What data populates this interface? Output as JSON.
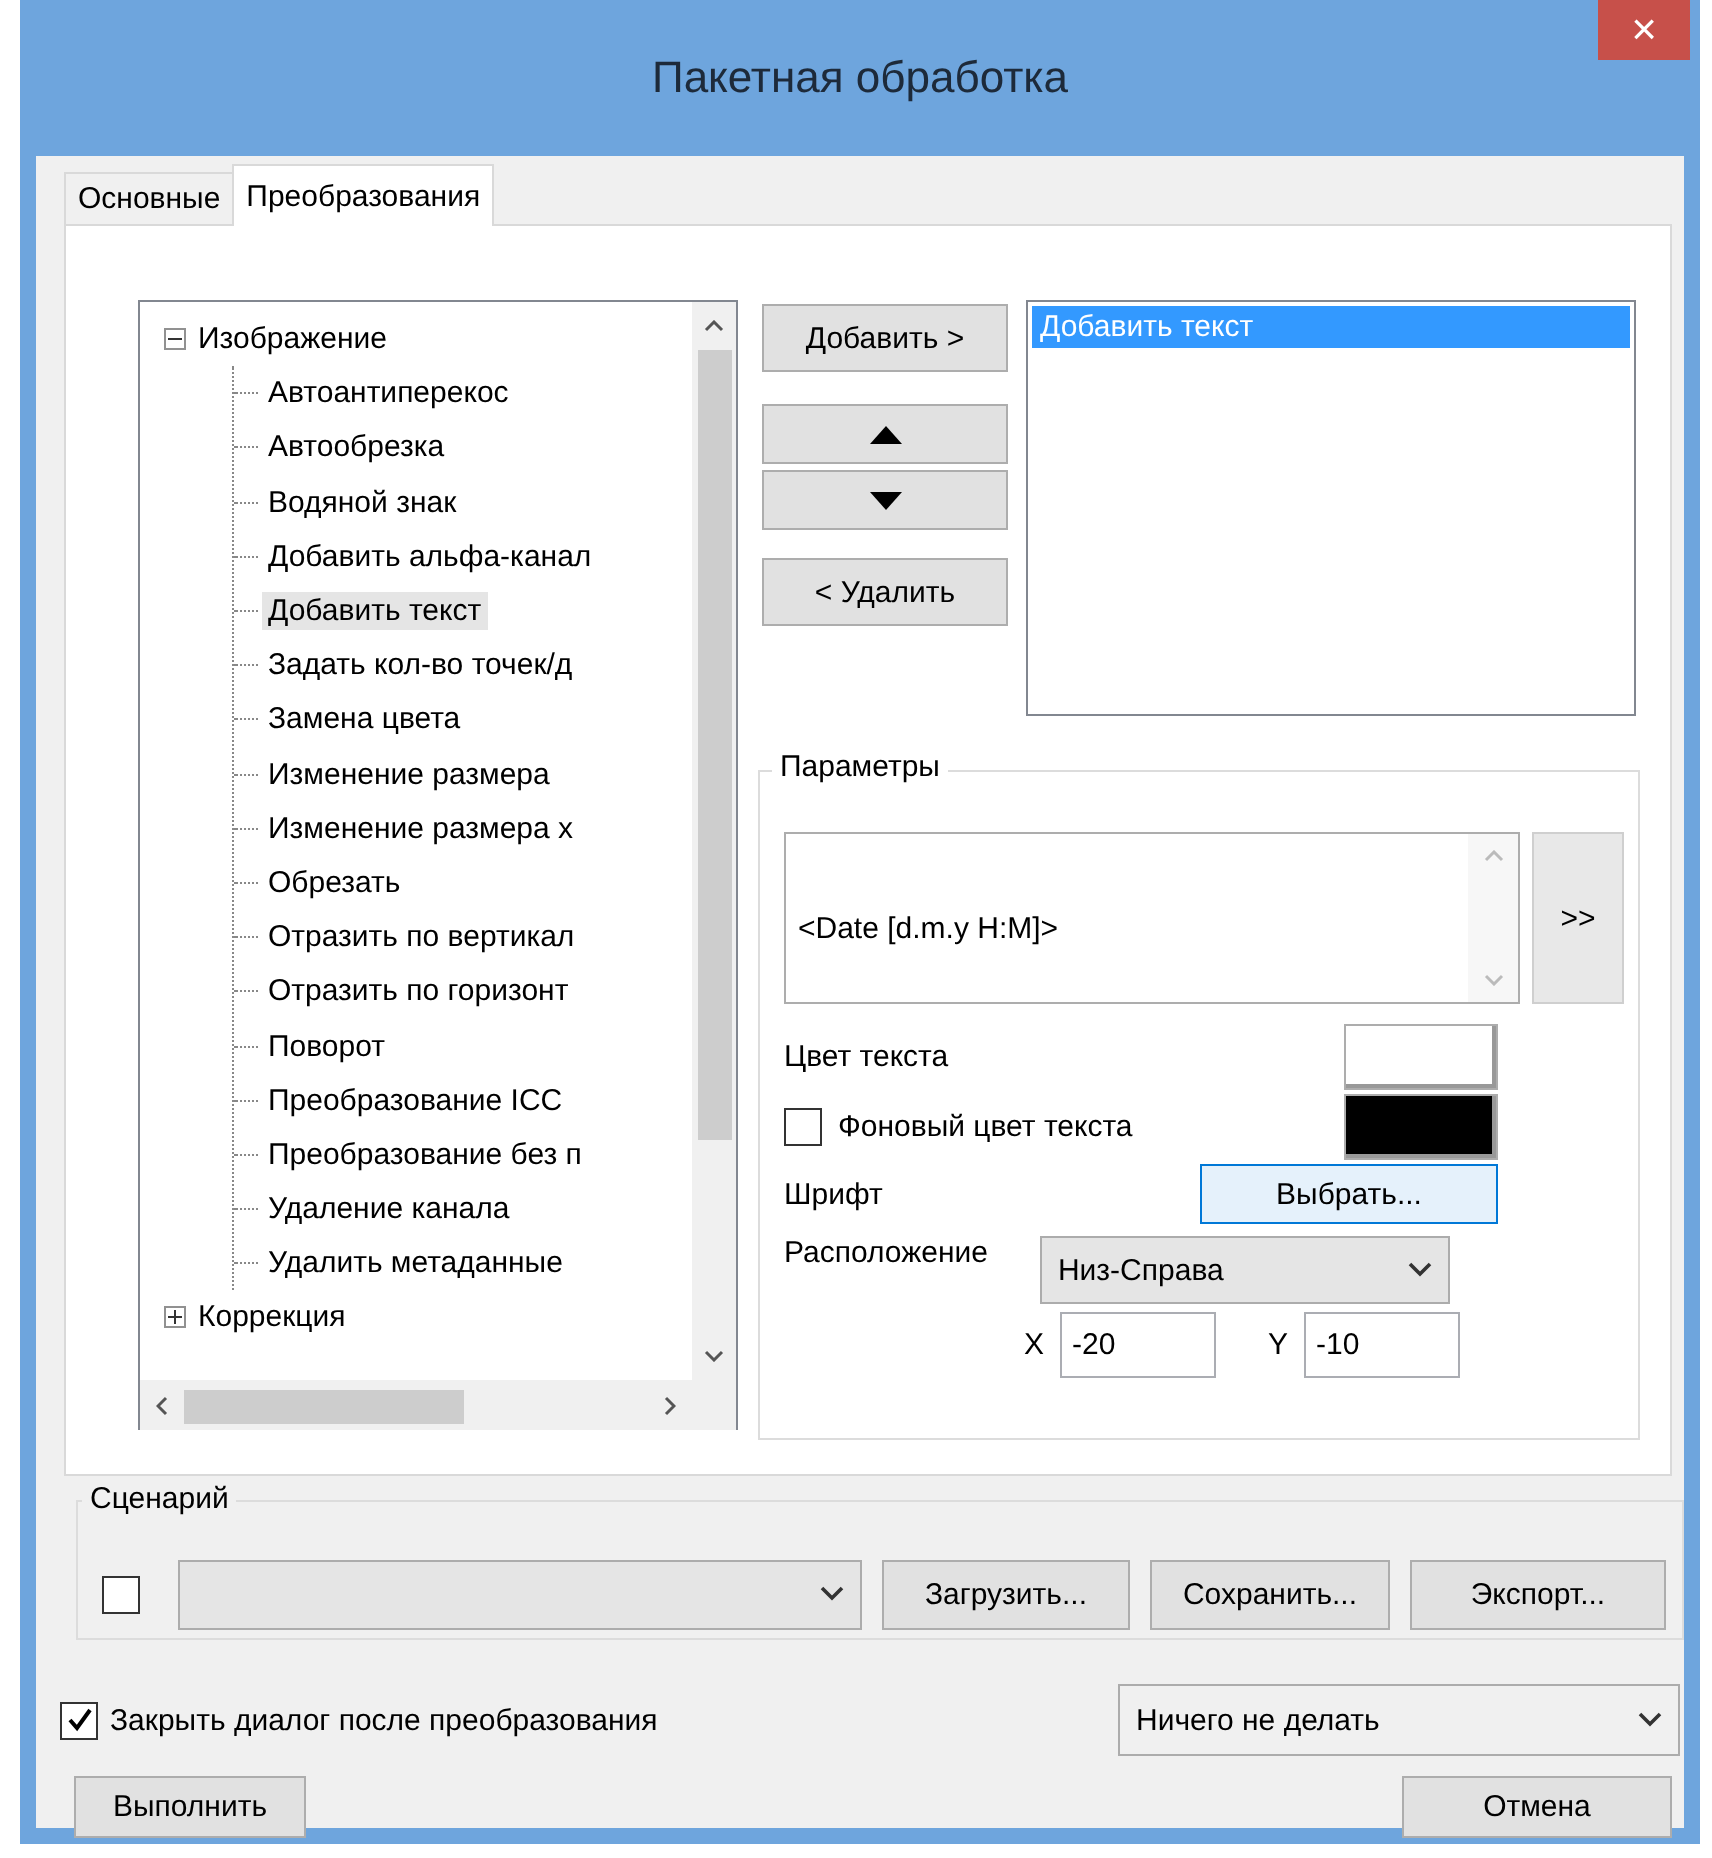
{
  "window": {
    "title": "Пакетная обработка",
    "close": "×"
  },
  "tabs": [
    {
      "label": "Основные",
      "selected": false
    },
    {
      "label": "Преобразования",
      "selected": true
    }
  ],
  "tree": [
    {
      "label": "Изображение",
      "expanded": true,
      "selected": false,
      "children": [
        {
          "label": "Автоантиперекос",
          "selected": false
        },
        {
          "label": "Автообрезка",
          "selected": false
        },
        {
          "label": "Водяной знак",
          "selected": false
        },
        {
          "label": "Добавить альфа-канал",
          "selected": false
        },
        {
          "label": "Добавить текст",
          "selected": true
        },
        {
          "label": "Задать кол-во точек/д",
          "selected": false
        },
        {
          "label": "Замена цвета",
          "selected": false
        },
        {
          "label": "Изменение размера",
          "selected": false
        },
        {
          "label": "Изменение размера х",
          "selected": false
        },
        {
          "label": "Обрезать",
          "selected": false
        },
        {
          "label": "Отразить по вертикал",
          "selected": false
        },
        {
          "label": "Отразить по горизонт",
          "selected": false
        },
        {
          "label": "Поворот",
          "selected": false
        },
        {
          "label": "Преобразование ICC",
          "selected": false
        },
        {
          "label": "Преобразование без п",
          "selected": false
        },
        {
          "label": "Удаление канала",
          "selected": false
        },
        {
          "label": "Удалить метаданные",
          "selected": false
        }
      ]
    },
    {
      "label": "Коррекция",
      "expanded": false,
      "selected": false
    }
  ],
  "add_button": "Добавить >",
  "remove_button": "< Удалить",
  "applied": [
    {
      "label": "Добавить текст",
      "selected": true
    }
  ],
  "parameters": {
    "title": "Параметры",
    "text_value": "<Date [d.m.y H:M]>",
    "insert_button": ">>",
    "text_color_label": "Цвет текста",
    "background_checkbox": {
      "label": "Фоновый цвет текста",
      "checked": false
    },
    "font_label": "Шрифт",
    "font_button": {
      "label": "Выбрать...",
      "focused": true
    },
    "position_label": "Расположение",
    "position_value": "Низ-Справа",
    "x_label": "X",
    "x_value": "-20",
    "y_label": "Y",
    "y_value": "-10"
  },
  "scenario": {
    "title": "Сценарий",
    "checked": false,
    "buttons": [
      "Загрузить...",
      "Сохранить...",
      "Экспорт..."
    ]
  },
  "close_after": {
    "label": "Закрыть диалог после преобразования",
    "checked": true
  },
  "after_action": "Ничего не делать",
  "run_button": "Выполнить",
  "cancel_button": "Отмена"
}
